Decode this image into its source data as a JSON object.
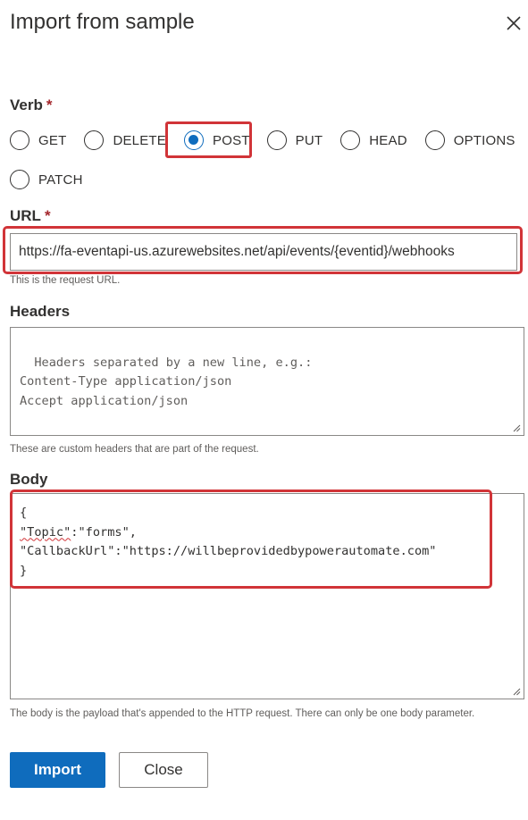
{
  "dialog": {
    "title": "Import from sample"
  },
  "verb": {
    "label": "Verb",
    "required_mark": "*",
    "options": [
      "GET",
      "DELETE",
      "POST",
      "PUT",
      "HEAD",
      "OPTIONS",
      "PATCH"
    ],
    "selected": "POST"
  },
  "url": {
    "label": "URL",
    "required_mark": "*",
    "value": "https://fa-eventapi-us.azurewebsites.net/api/events/{eventid}/webhooks",
    "help": "This is the request URL."
  },
  "headers": {
    "label": "Headers",
    "placeholder": "Headers separated by a new line, e.g.:\nContent-Type application/json\nAccept application/json",
    "help": "These are custom headers that are part of the request."
  },
  "body": {
    "label": "Body",
    "line1": "{",
    "line2_key": "\"Topic\"",
    "line2_rest": ":\"forms\",",
    "line3": "\"CallbackUrl\":\"https://willbeprovidedbypowerautomate.com\"",
    "line4": "}",
    "help": "The body is the payload that's appended to the HTTP request. There can only be one body parameter."
  },
  "actions": {
    "import_label": "Import",
    "close_label": "Close"
  },
  "colors": {
    "accent": "#0f6cbd",
    "highlight": "#d13438",
    "required": "#a4262c"
  }
}
